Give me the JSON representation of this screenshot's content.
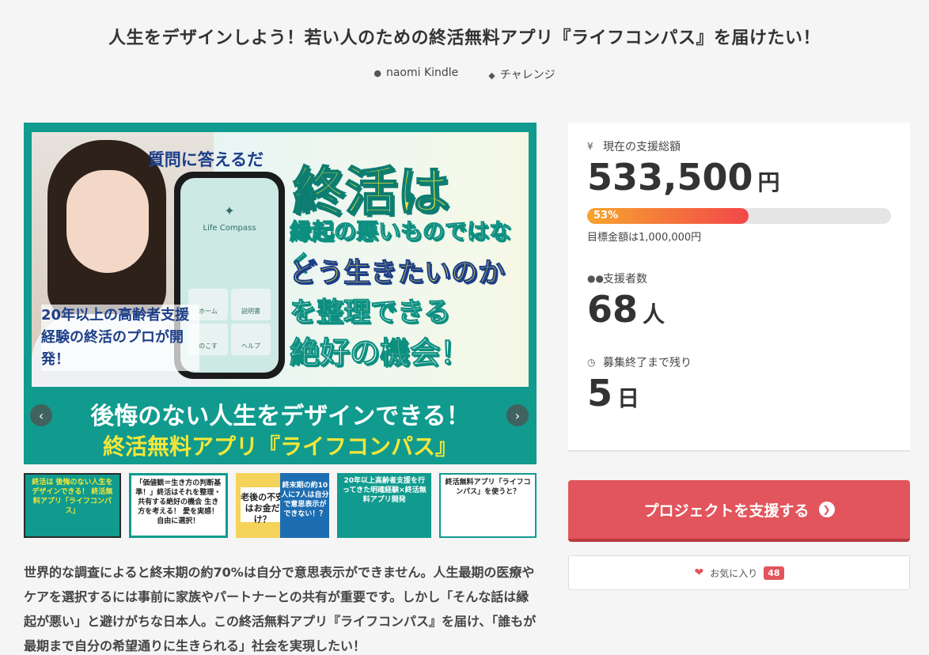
{
  "project": {
    "title": "人生をデザインしよう！若い人のための終活無料アプリ『ライフコンパス』を届けたい！",
    "author": "naomi Kindle",
    "category": "チャレンジ"
  },
  "hero": {
    "question": "質問に答えるだけ！",
    "app_name": "Life Compass",
    "app_buttons": [
      "ホーム",
      "説明書",
      "のこす",
      "ヘルプ"
    ],
    "left_text": "20年以上の高齢者支援経験の終活のプロが開発！",
    "headline1": "終活は",
    "headline2": "縁起の悪いものではなく",
    "headline3": "どう生きたいのか",
    "headline4": "を整理できる",
    "headline5": "絶好の機会！",
    "bottom1": "後悔のない人生をデザインできる！",
    "bottom2": "終活無料アプリ『ライフコンパス』",
    "prev": "‹",
    "next": "›"
  },
  "thumbnails": [
    {
      "caption": "終活は 後悔のない人生をデザインできる！ 終活無料アプリ「ライフコンパス」"
    },
    {
      "caption": "「価値観＝生き方の判断基準！」終活はそれを整理・共有する絶好の機会 生き方を考える！ 愛を実感！ 自由に選択！"
    },
    {
      "caption": "老後の不安はお金だけ？",
      "right": "終末期の約10人に7人は自分で意思表示ができない！？"
    },
    {
      "caption": "20年以上高齢者支援を行ってきた明確経験×終活無料アプリ開発"
    },
    {
      "caption": "終活無料アプリ「ライフコンパス」を使うと？"
    }
  ],
  "description": "世界的な調査によると終末期の約70%は自分で意思表示ができません。人生最期の医療やケアを選択するには事前に家族やパートナーとの共有が重要です。しかし「そんな話は縁起が悪い」と避けがちな日本人。この終活無料アプリ『ライフコンパス』を届け、「誰もが最期まで自分の希望通りに生きられる」社会を実現したい！",
  "stats": {
    "total_label": "現在の支援総額",
    "total_value": "533,500",
    "total_unit": "円",
    "progress_label": "53%",
    "progress": 0.53,
    "goal_text": "目標金額は1,000,000円",
    "supporters_label": "支援者数",
    "supporters_value": "68",
    "supporters_unit": "人",
    "remaining_label": "募集終了まで残り",
    "remaining_value": "5",
    "remaining_unit": "日"
  },
  "actions": {
    "support_label": "プロジェクトを支援する",
    "favorite_label": "お気に入り",
    "favorite_count": "48"
  },
  "colors": {
    "accent": "#e2555c",
    "teal": "#109b8e",
    "yellow": "#f3e63a"
  }
}
